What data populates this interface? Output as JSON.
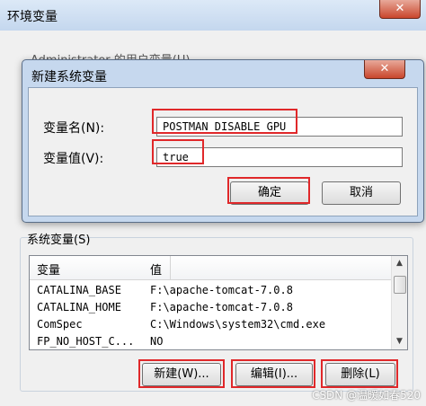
{
  "outer": {
    "title": "环境变量",
    "user_vars_label": "Administrator 的用户变量(U)",
    "sys_vars_label": "系统变量(S)",
    "columns": [
      "变量",
      "值"
    ],
    "rows": [
      {
        "name": "CATALINA_BASE",
        "value": "F:\\apache-tomcat-7.0.8"
      },
      {
        "name": "CATALINA_HOME",
        "value": "F:\\apache-tomcat-7.0.8"
      },
      {
        "name": "ComSpec",
        "value": "C:\\Windows\\system32\\cmd.exe"
      },
      {
        "name": "FP_NO_HOST_C...",
        "value": "NO"
      }
    ],
    "buttons": {
      "new": "新建(W)...",
      "edit": "编辑(I)...",
      "delete": "删除(L)"
    },
    "close_glyph": "✕"
  },
  "dialog": {
    "title": "新建系统变量",
    "name_label": "变量名(N):",
    "value_label": "变量值(V):",
    "name_value": "POSTMAN_DISABLE_GPU",
    "value_value": "true",
    "ok": "确定",
    "cancel": "取消",
    "close_glyph": "✕"
  },
  "watermark": "CSDN @温暖如春520",
  "colors": {
    "highlight_red": "#e0282a",
    "titlebar_blue": "#c6d8ee"
  }
}
